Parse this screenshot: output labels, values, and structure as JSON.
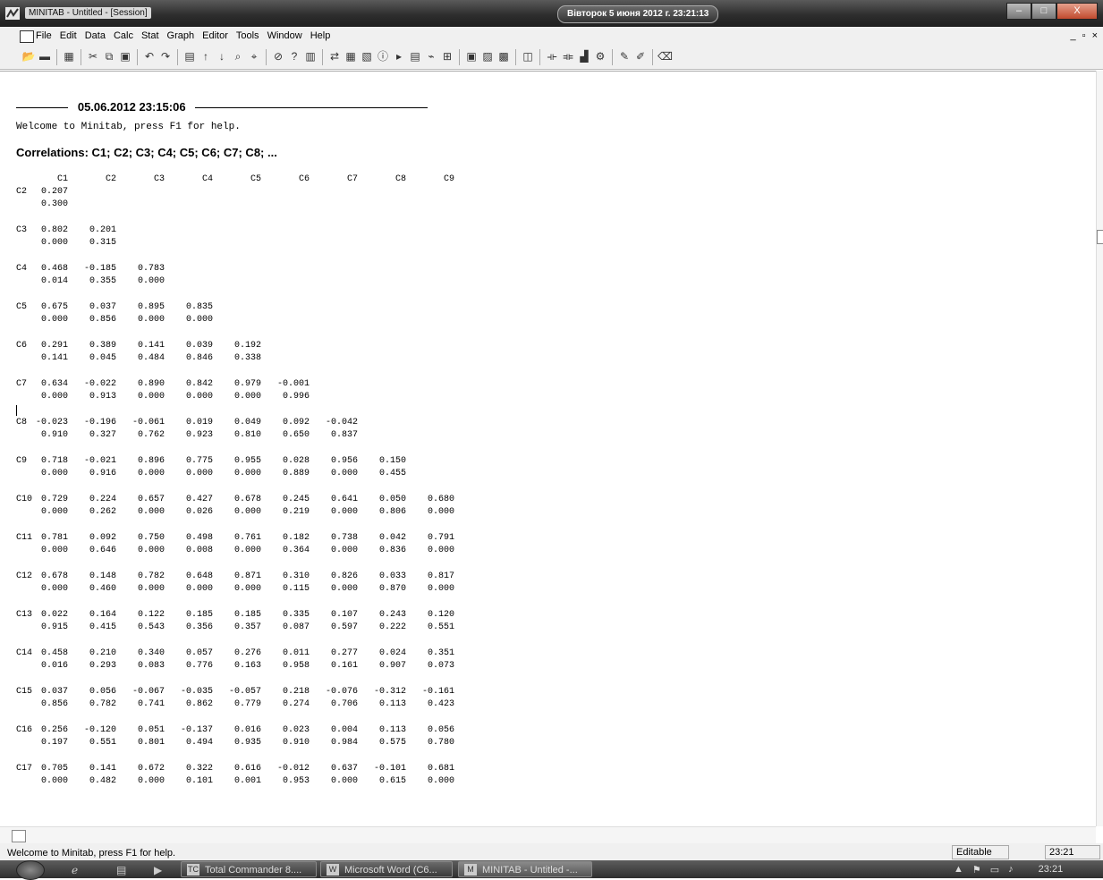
{
  "window": {
    "title": "MINITAB - Untitled - [Session]",
    "clock": "Вівторок  5 июня 2012 г.  23:21:13",
    "min_label": "–",
    "max_label": "□",
    "close_label": "X"
  },
  "menu": [
    "File",
    "Edit",
    "Data",
    "Calc",
    "Stat",
    "Graph",
    "Editor",
    "Tools",
    "Window",
    "Help"
  ],
  "mdi_controls": "_ ▫ ×",
  "toolbar_icons": [
    "open-icon",
    "save-icon",
    "|",
    "print-icon",
    "|",
    "cut-icon",
    "copy-icon",
    "paste-icon",
    "|",
    "undo-icon",
    "redo-icon",
    "|",
    "session-icon",
    "up-arrow-icon",
    "down-arrow-icon",
    "find-icon",
    "find-next-icon",
    "|",
    "cancel-icon",
    "help-icon",
    "book-icon",
    "|",
    "graph-icon",
    "worksheet-icon",
    "worksheet2-icon",
    "info-icon",
    "history-icon",
    "report-icon",
    "pin-icon",
    "layout-icon",
    "|",
    "manager-icon",
    "window-icon",
    "grid-icon",
    "|",
    "chart-icon",
    "|",
    "brush-icon",
    "brush2-icon",
    "data-icon",
    "tool-icon",
    "|",
    "edit-icon",
    "edit2-icon",
    "|",
    "eraser-icon"
  ],
  "session": {
    "timestamp": "05.06.2012 23:15:06",
    "welcome": "Welcome to Minitab, press F1 for help.",
    "heading": "Correlations: C1; C2; C3; C4; C5; C6; C7; C8; ...",
    "columns": [
      "C1",
      "C2",
      "C3",
      "C4",
      "C5",
      "C6",
      "C7",
      "C8",
      "C9"
    ],
    "rows": [
      {
        "label": "C2",
        "r": [
          "0.207"
        ],
        "p": [
          "0.300"
        ]
      },
      {
        "label": "C3",
        "r": [
          "0.802",
          "0.201"
        ],
        "p": [
          "0.000",
          "0.315"
        ]
      },
      {
        "label": "C4",
        "r": [
          "0.468",
          "-0.185",
          "0.783"
        ],
        "p": [
          "0.014",
          "0.355",
          "0.000"
        ]
      },
      {
        "label": "C5",
        "r": [
          "0.675",
          "0.037",
          "0.895",
          "0.835"
        ],
        "p": [
          "0.000",
          "0.856",
          "0.000",
          "0.000"
        ]
      },
      {
        "label": "C6",
        "r": [
          "0.291",
          "0.389",
          "0.141",
          "0.039",
          "0.192"
        ],
        "p": [
          "0.141",
          "0.045",
          "0.484",
          "0.846",
          "0.338"
        ]
      },
      {
        "label": "C7",
        "r": [
          "0.634",
          "-0.022",
          "0.890",
          "0.842",
          "0.979",
          "-0.001"
        ],
        "p": [
          "0.000",
          "0.913",
          "0.000",
          "0.000",
          "0.000",
          "0.996"
        ]
      },
      {
        "label": "C8",
        "r": [
          "-0.023",
          "-0.196",
          "-0.061",
          "0.019",
          "0.049",
          "0.092",
          "-0.042"
        ],
        "p": [
          "0.910",
          "0.327",
          "0.762",
          "0.923",
          "0.810",
          "0.650",
          "0.837"
        ]
      },
      {
        "label": "C9",
        "r": [
          "0.718",
          "-0.021",
          "0.896",
          "0.775",
          "0.955",
          "0.028",
          "0.956",
          "0.150"
        ],
        "p": [
          "0.000",
          "0.916",
          "0.000",
          "0.000",
          "0.000",
          "0.889",
          "0.000",
          "0.455"
        ]
      },
      {
        "label": "C10",
        "r": [
          "0.729",
          "0.224",
          "0.657",
          "0.427",
          "0.678",
          "0.245",
          "0.641",
          "0.050",
          "0.680"
        ],
        "p": [
          "0.000",
          "0.262",
          "0.000",
          "0.026",
          "0.000",
          "0.219",
          "0.000",
          "0.806",
          "0.000"
        ]
      },
      {
        "label": "C11",
        "r": [
          "0.781",
          "0.092",
          "0.750",
          "0.498",
          "0.761",
          "0.182",
          "0.738",
          "0.042",
          "0.791"
        ],
        "p": [
          "0.000",
          "0.646",
          "0.000",
          "0.008",
          "0.000",
          "0.364",
          "0.000",
          "0.836",
          "0.000"
        ]
      },
      {
        "label": "C12",
        "r": [
          "0.678",
          "0.148",
          "0.782",
          "0.648",
          "0.871",
          "0.310",
          "0.826",
          "0.033",
          "0.817"
        ],
        "p": [
          "0.000",
          "0.460",
          "0.000",
          "0.000",
          "0.000",
          "0.115",
          "0.000",
          "0.870",
          "0.000"
        ]
      },
      {
        "label": "C13",
        "r": [
          "0.022",
          "0.164",
          "0.122",
          "0.185",
          "0.185",
          "0.335",
          "0.107",
          "0.243",
          "0.120"
        ],
        "p": [
          "0.915",
          "0.415",
          "0.543",
          "0.356",
          "0.357",
          "0.087",
          "0.597",
          "0.222",
          "0.551"
        ]
      },
      {
        "label": "C14",
        "r": [
          "0.458",
          "0.210",
          "0.340",
          "0.057",
          "0.276",
          "0.011",
          "0.277",
          "0.024",
          "0.351"
        ],
        "p": [
          "0.016",
          "0.293",
          "0.083",
          "0.776",
          "0.163",
          "0.958",
          "0.161",
          "0.907",
          "0.073"
        ]
      },
      {
        "label": "C15",
        "r": [
          "0.037",
          "0.056",
          "-0.067",
          "-0.035",
          "-0.057",
          "0.218",
          "-0.076",
          "-0.312",
          "-0.161"
        ],
        "p": [
          "0.856",
          "0.782",
          "0.741",
          "0.862",
          "0.779",
          "0.274",
          "0.706",
          "0.113",
          "0.423"
        ]
      },
      {
        "label": "C16",
        "r": [
          "0.256",
          "-0.120",
          "0.051",
          "-0.137",
          "0.016",
          "0.023",
          "0.004",
          "0.113",
          "0.056"
        ],
        "p": [
          "0.197",
          "0.551",
          "0.801",
          "0.494",
          "0.935",
          "0.910",
          "0.984",
          "0.575",
          "0.780"
        ]
      },
      {
        "label": "C17",
        "r": [
          "0.705",
          "0.141",
          "0.672",
          "0.322",
          "0.616",
          "-0.012",
          "0.637",
          "-0.101",
          "0.681"
        ],
        "p": [
          "0.000",
          "0.482",
          "0.000",
          "0.101",
          "0.001",
          "0.953",
          "0.000",
          "0.615",
          "0.000"
        ]
      }
    ]
  },
  "statusbar": {
    "message": "Welcome to Minitab, press F1 for help.",
    "mode": "Editable",
    "time": "23:21"
  },
  "taskbar": {
    "buttons": [
      {
        "label": "Total Commander 8....",
        "icon": "TC"
      },
      {
        "label": "Microsoft Word (C6...",
        "icon": "W"
      },
      {
        "label": "MINITAB - Untitled -...",
        "icon": "M"
      }
    ],
    "time": "23:21"
  }
}
